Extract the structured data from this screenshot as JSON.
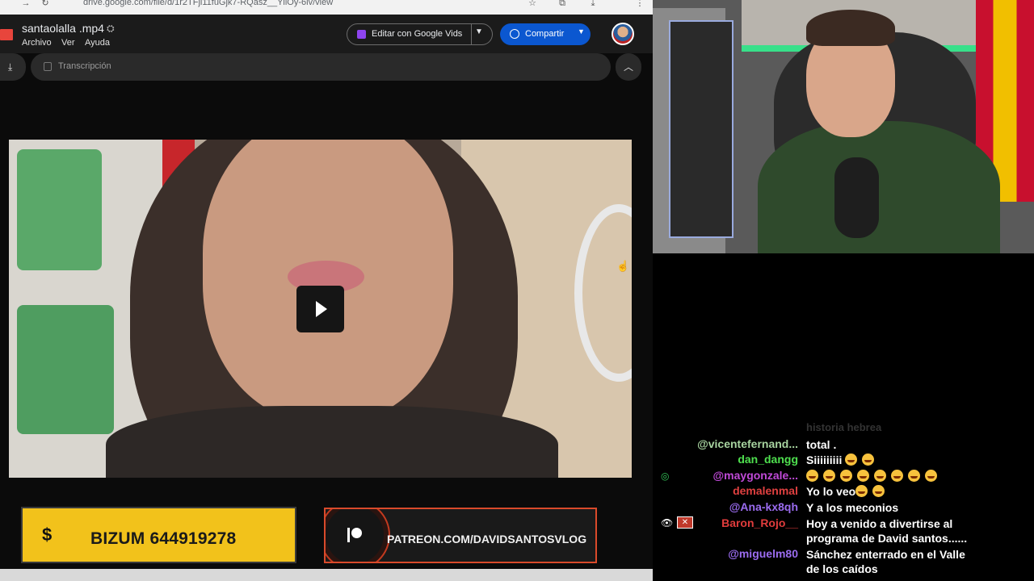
{
  "browser": {
    "url": "drive.google.com/file/d/1r2TFjl11fuGjk7-RQasz__YliOy-6lv/view"
  },
  "drive": {
    "file_title": "santaolalla .mp4",
    "menu": [
      "Archivo",
      "Ver",
      "Ayuda"
    ],
    "edit_button": "Editar con Google Vids",
    "share_button": "Compartir",
    "transcript_label": "Transcripción"
  },
  "banners": {
    "bizum_symbol": "$",
    "bizum_text": "BIZUM 644919278",
    "patreon_text": "PATREON.COM/DAVIDSANTOSVLOG"
  },
  "chat": {
    "faded_text": "historia hebrea",
    "messages": [
      {
        "user": "@vicentefernand...",
        "text": "total .",
        "color": "#a8d4a0"
      },
      {
        "user": "dan_dangg",
        "text": "Siiiiiiiii",
        "color": "#4fe04f",
        "emojis": 2
      },
      {
        "user": "@maygonzale...",
        "text": "",
        "color": "#c04ad8",
        "emojis": 8
      },
      {
        "user": "demalenmal",
        "text": "Yo lo veo",
        "color": "#e04040",
        "emojis": 2
      },
      {
        "user": "@Ana-kx8qh",
        "text": "Y a los meconios",
        "color": "#9b6cf0"
      },
      {
        "user": "Baron_Rojo__",
        "text": "Hoy a venido a divertirse al",
        "text2": "programa de David santos......",
        "color": "#e03c3c"
      },
      {
        "user": "@miguelm80",
        "text": "Sánchez enterrado en el Valle",
        "text2": "de los caídos",
        "color": "#9b6cf0"
      }
    ]
  },
  "colors": {
    "share_blue": "#0b57d0",
    "bizum_yellow": "#f2c21b",
    "patreon_red": "#d94a2b"
  }
}
